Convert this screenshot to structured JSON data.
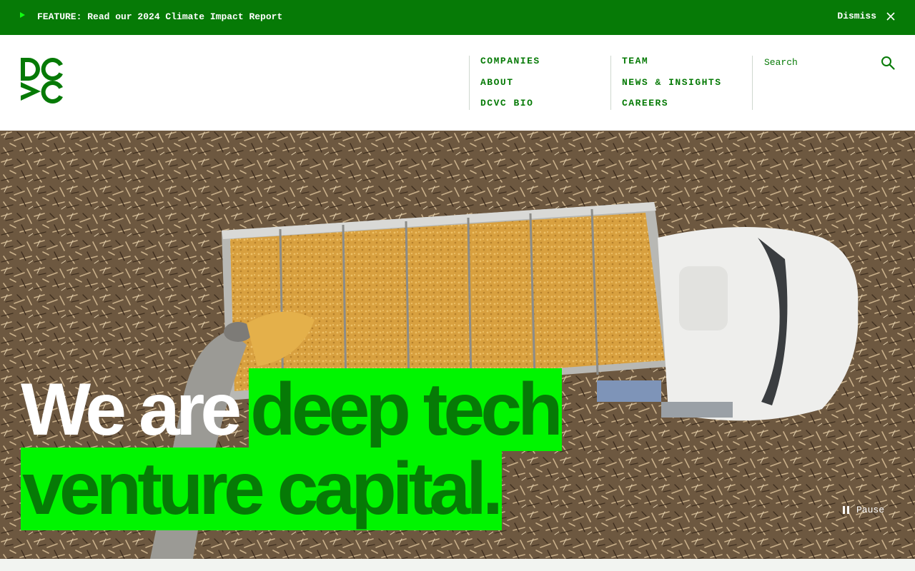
{
  "banner": {
    "feature_text": "FEATURE: Read our 2024 Climate Impact Report",
    "dismiss_label": "Dismiss",
    "play_icon": "play-triangle-icon",
    "close_icon": "close-icon",
    "bg_color": "#067a06",
    "accent_color": "#10ff10"
  },
  "header": {
    "logo_alt": "DCVC",
    "nav_columns": [
      {
        "items": [
          {
            "label": "COMPANIES"
          },
          {
            "label": "ABOUT"
          },
          {
            "label": "DCVC BIO"
          }
        ]
      },
      {
        "items": [
          {
            "label": "TEAM"
          },
          {
            "label": "NEWS & INSIGHTS"
          },
          {
            "label": "CAREERS"
          }
        ]
      }
    ],
    "search": {
      "placeholder": "Search",
      "icon": "search-icon"
    },
    "brand_color": "#067a06"
  },
  "hero": {
    "headline_plain": "We are",
    "headline_highlight_line1": "deep tech",
    "headline_highlight_line2": "venture capital.",
    "highlight_color": "#00f500",
    "pause_label": "Pause",
    "pause_icon": "pause-icon"
  }
}
